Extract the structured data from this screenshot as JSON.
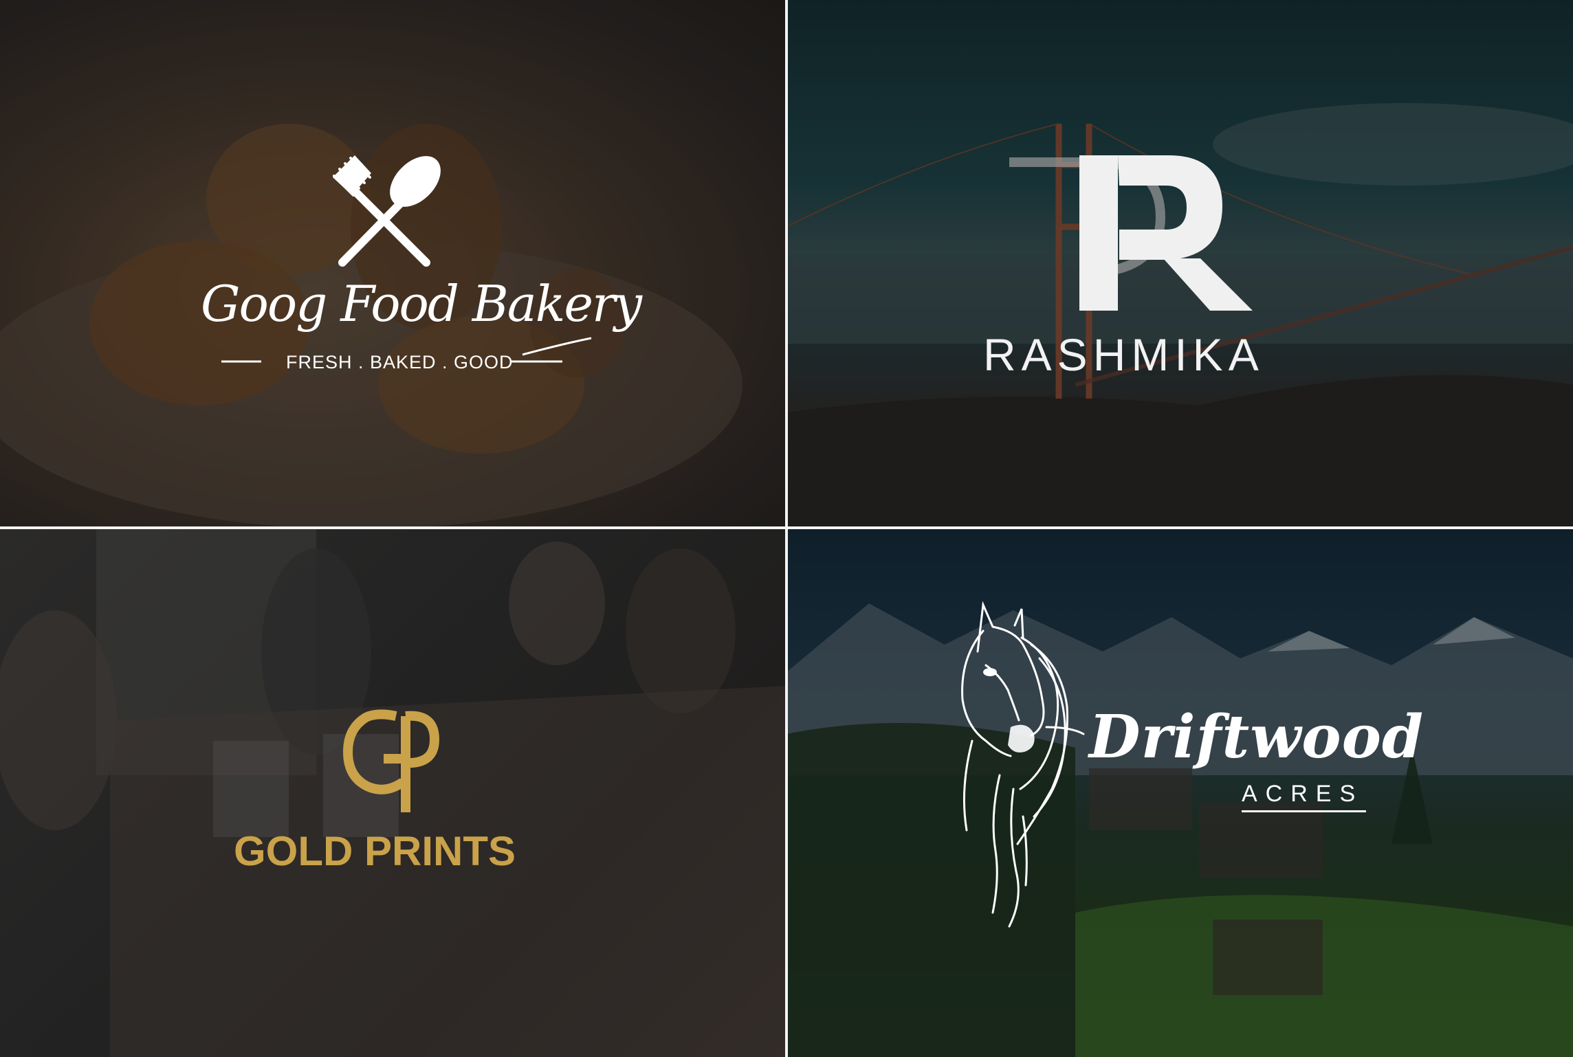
{
  "logos": [
    {
      "brand": "Goog Food Bakery",
      "tagline": "FRESH . BAKED . GOOD",
      "icon": "fork-spoon-icon",
      "color": "#ffffff"
    },
    {
      "monogram": "R",
      "brand": "RASHMIKA",
      "icon": "r-monogram-icon",
      "color": "#f2f2f2"
    },
    {
      "monogram": "GP",
      "brand": "GOLD PRINTS",
      "icon": "gp-monogram-icon",
      "color": "#c9a24a"
    },
    {
      "brand": "Driftwood",
      "subbrand": "ACRES",
      "icon": "horse-head-icon",
      "color": "#ffffff"
    }
  ]
}
